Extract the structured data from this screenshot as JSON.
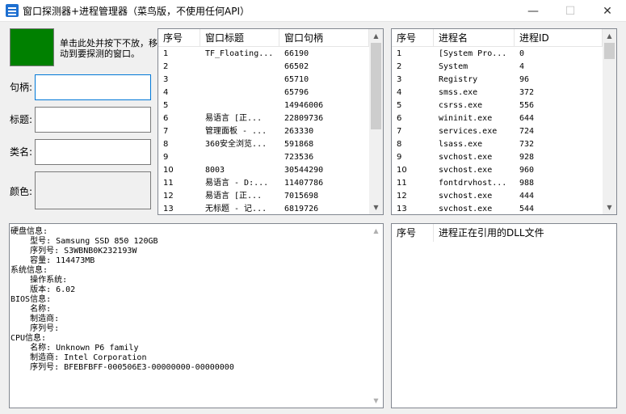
{
  "window": {
    "title": "窗口探测器+进程管理器（菜鸟版，不使用任何API）",
    "controls": [
      "—",
      "☐",
      "✕"
    ]
  },
  "probe": {
    "color": "#008000",
    "hint": "单击此处并按下不放，移动到要探测的窗口。",
    "fields": [
      {
        "label": "句柄:",
        "value": ""
      },
      {
        "label": "标题:",
        "value": ""
      },
      {
        "label": "类名:",
        "value": ""
      },
      {
        "label": "颜色:",
        "value": ""
      }
    ]
  },
  "windows_list": {
    "columns": [
      "序号",
      "窗口标题",
      "窗口句柄"
    ],
    "rows": [
      [
        "1",
        "TF_Floating...",
        "66190"
      ],
      [
        "2",
        "",
        "66502"
      ],
      [
        "3",
        "",
        "65710"
      ],
      [
        "4",
        "",
        "65796"
      ],
      [
        "5",
        "",
        "14946006"
      ],
      [
        "6",
        "易语言 [正...",
        "22809736"
      ],
      [
        "7",
        "管理面板 - ...",
        "263330"
      ],
      [
        "8",
        "360安全浏览...",
        "591868"
      ],
      [
        "9",
        "",
        "723536"
      ],
      [
        "10",
        "8003",
        "30544290"
      ],
      [
        "11",
        "易语言 - D:...",
        "11407786"
      ],
      [
        "12",
        "易语言 [正...",
        "7015698"
      ],
      [
        "13",
        "无标题 - 记...",
        "6819726"
      ]
    ]
  },
  "process_list": {
    "columns": [
      "序号",
      "进程名",
      "进程ID"
    ],
    "rows": [
      [
        "1",
        "[System Pro...",
        "0"
      ],
      [
        "2",
        "System",
        "4"
      ],
      [
        "3",
        "Registry",
        "96"
      ],
      [
        "4",
        "smss.exe",
        "372"
      ],
      [
        "5",
        "csrss.exe",
        "556"
      ],
      [
        "6",
        "wininit.exe",
        "644"
      ],
      [
        "7",
        "services.exe",
        "724"
      ],
      [
        "8",
        "lsass.exe",
        "732"
      ],
      [
        "9",
        "svchost.exe",
        "928"
      ],
      [
        "10",
        "svchost.exe",
        "960"
      ],
      [
        "11",
        "fontdrvhost...",
        "988"
      ],
      [
        "12",
        "svchost.exe",
        "444"
      ],
      [
        "13",
        "svchost.exe",
        "544"
      ]
    ]
  },
  "dll_list": {
    "columns": [
      "序号",
      "进程正在引用的DLL文件"
    ]
  },
  "system_info": {
    "text": "硬盘信息:\n    型号: Samsung SSD 850 120GB\n    序列号: S3WBNB0K232193W\n    容量: 114473MB\n系统信息:\n    操作系统:\n    版本: 6.02\nBIOS信息:\n    名称:\n    制造商:\n    序列号:\nCPU信息:\n    名称: Unknown P6 family\n    制造商: Intel Corporation\n    序列号: BFEBFBFF-000506E3-00000000-00000000"
  }
}
